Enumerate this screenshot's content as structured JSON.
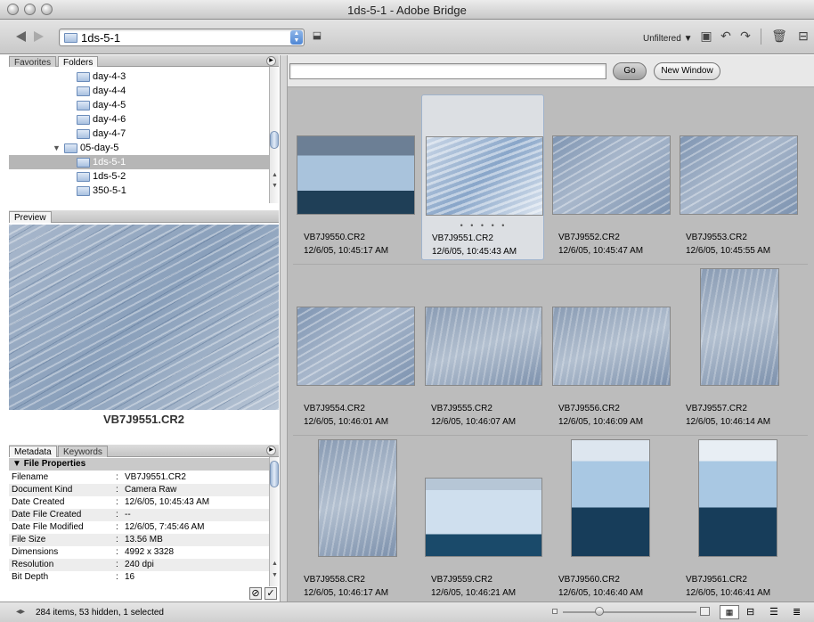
{
  "window": {
    "title": "1ds-5-1 - Adobe Bridge"
  },
  "toolbar": {
    "path": "1ds-5-1",
    "filter_label": "Unfiltered ▼"
  },
  "left_panel": {
    "tabs": [
      "Favorites",
      "Folders"
    ],
    "folders": [
      {
        "label": "day-4-3",
        "selected": false
      },
      {
        "label": "day-4-4",
        "selected": false
      },
      {
        "label": "day-4-5",
        "selected": false
      },
      {
        "label": "day-4-6",
        "selected": false
      },
      {
        "label": "day-4-7",
        "selected": false
      },
      {
        "label": "05-day-5",
        "selected": false
      },
      {
        "label": "1ds-5-1",
        "selected": true
      },
      {
        "label": "1ds-5-2",
        "selected": false
      },
      {
        "label": "350-5-1",
        "selected": false
      }
    ],
    "preview_tab": "Preview",
    "preview_filename": "VB7J9551.CR2",
    "metadata_tabs": [
      "Metadata",
      "Keywords"
    ],
    "metadata_section": "File Properties",
    "metadata": [
      {
        "key": "Filename",
        "value": "VB7J9551.CR2"
      },
      {
        "key": "Document Kind",
        "value": "Camera Raw"
      },
      {
        "key": "Date Created",
        "value": "12/6/05, 10:45:43 AM"
      },
      {
        "key": "Date File Created",
        "value": "--"
      },
      {
        "key": "Date File Modified",
        "value": "12/6/05, 7:45:46 AM"
      },
      {
        "key": "File Size",
        "value": "13.56 MB"
      },
      {
        "key": "Dimensions",
        "value": "4992 x 3328"
      },
      {
        "key": "Resolution",
        "value": "240 dpi"
      },
      {
        "key": "Bit Depth",
        "value": "16"
      }
    ]
  },
  "content": {
    "search_value": "",
    "go_label": "Go",
    "new_window_label": "New Window",
    "thumbnails": [
      {
        "name": "VB7J9550.CR2",
        "date": "12/6/05, 10:45:17 AM"
      },
      {
        "name": "VB7J9551.CR2",
        "date": "12/6/05, 10:45:43 AM"
      },
      {
        "name": "VB7J9552.CR2",
        "date": "12/6/05, 10:45:47 AM"
      },
      {
        "name": "VB7J9553.CR2",
        "date": "12/6/05, 10:45:55 AM"
      },
      {
        "name": "VB7J9554.CR2",
        "date": "12/6/05, 10:46:01 AM"
      },
      {
        "name": "VB7J9555.CR2",
        "date": "12/6/05, 10:46:07 AM"
      },
      {
        "name": "VB7J9556.CR2",
        "date": "12/6/05, 10:46:09 AM"
      },
      {
        "name": "VB7J9557.CR2",
        "date": "12/6/05, 10:46:14 AM"
      },
      {
        "name": "VB7J9558.CR2",
        "date": "12/6/05, 10:46:17 AM"
      },
      {
        "name": "VB7J9559.CR2",
        "date": "12/6/05, 10:46:21 AM"
      },
      {
        "name": "VB7J9560.CR2",
        "date": "12/6/05, 10:46:40 AM"
      },
      {
        "name": "VB7J9561.CR2",
        "date": "12/6/05, 10:46:41 AM"
      }
    ],
    "selected_rating_dots": "• • • • •"
  },
  "status": {
    "text": "284 items, 53 hidden, 1 selected"
  }
}
